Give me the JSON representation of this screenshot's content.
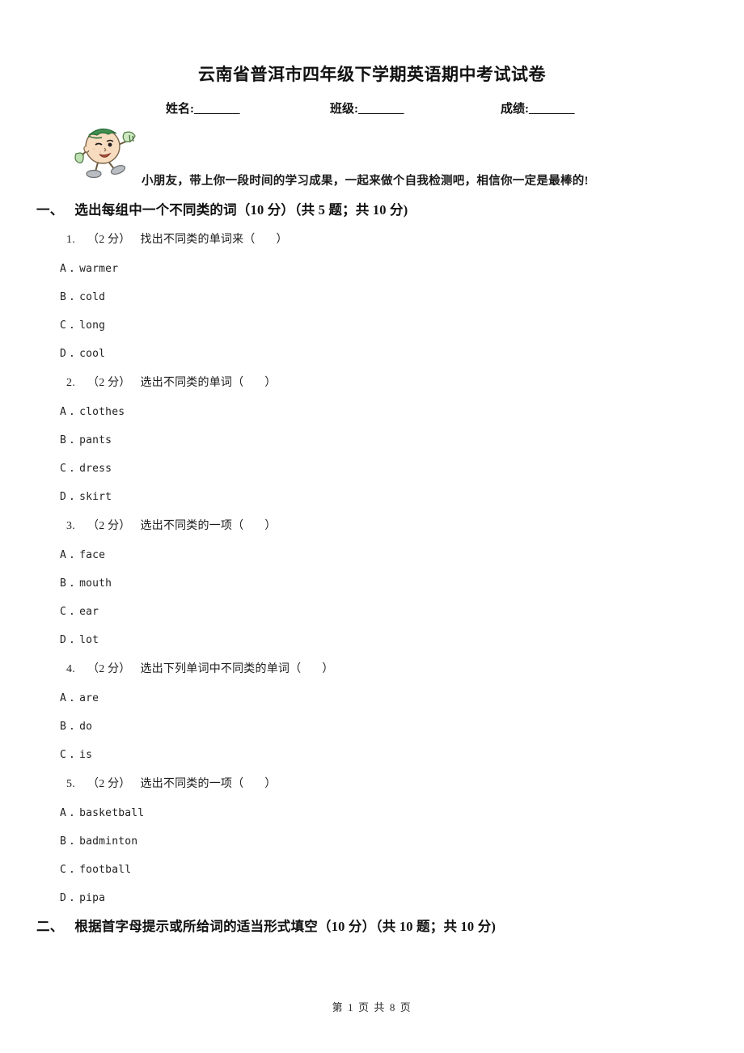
{
  "document": {
    "title": "云南省普洱市四年级下学期英语期中考试试卷",
    "fields": [
      {
        "label": "姓名:",
        "blank": "________"
      },
      {
        "label": "班级:",
        "blank": "________"
      },
      {
        "label": "成绩:",
        "blank": "________"
      }
    ],
    "greeting": "小朋友，带上你一段时间的学习成果，一起来做个自我检测吧，相信你一定是最棒的!",
    "mascot_alt": "cartoon-boy-with-green-cap"
  },
  "sections": [
    {
      "number": "一、",
      "title": "选出每组中一个不同类的词（10 分）",
      "meta": "（共 5 题；共 10 分)"
    },
    {
      "number": "二、",
      "title": "根据首字母提示或所给词的适当形式填空（10 分）",
      "meta": "（共 10 题；共 10 分)"
    }
  ],
  "questions": [
    {
      "num": "1.",
      "score": "（2 分）",
      "stem": "找出不同类的单词来（",
      "close": "）",
      "options": [
        {
          "letter": "A",
          "dot": ".",
          "text": "warmer"
        },
        {
          "letter": "B",
          "dot": ".",
          "text": "cold"
        },
        {
          "letter": "C",
          "dot": ".",
          "text": "long"
        },
        {
          "letter": "D",
          "dot": ".",
          "text": "cool"
        }
      ]
    },
    {
      "num": "2.",
      "score": "（2 分）",
      "stem": "选出不同类的单词（",
      "close": "）",
      "options": [
        {
          "letter": "A",
          "dot": ".",
          "text": "clothes"
        },
        {
          "letter": "B",
          "dot": ".",
          "text": "pants"
        },
        {
          "letter": "C",
          "dot": ".",
          "text": "dress"
        },
        {
          "letter": "D",
          "dot": ".",
          "text": "skirt"
        }
      ]
    },
    {
      "num": "3.",
      "score": "（2 分）",
      "stem": "选出不同类的一项（",
      "close": "）",
      "options": [
        {
          "letter": "A",
          "dot": ".",
          "text": "face"
        },
        {
          "letter": "B",
          "dot": ".",
          "text": "mouth"
        },
        {
          "letter": "C",
          "dot": ".",
          "text": "ear"
        },
        {
          "letter": "D",
          "dot": ".",
          "text": "lot"
        }
      ]
    },
    {
      "num": "4.",
      "score": "（2 分）",
      "stem": "选出下列单词中不同类的单词（",
      "close": "）",
      "options": [
        {
          "letter": "A",
          "dot": ".",
          "text": "are"
        },
        {
          "letter": "B",
          "dot": ".",
          "text": "do"
        },
        {
          "letter": "C",
          "dot": ".",
          "text": "is"
        }
      ]
    },
    {
      "num": "5.",
      "score": "（2 分）",
      "stem": "选出不同类的一项（",
      "close": "）",
      "options": [
        {
          "letter": "A",
          "dot": ".",
          "text": "basketball"
        },
        {
          "letter": "B",
          "dot": ".",
          "text": "badminton"
        },
        {
          "letter": "C",
          "dot": ".",
          "text": "football"
        },
        {
          "letter": "D",
          "dot": ".",
          "text": "pipa"
        }
      ]
    }
  ],
  "footer": {
    "text": "第 1 页 共 8 页"
  }
}
